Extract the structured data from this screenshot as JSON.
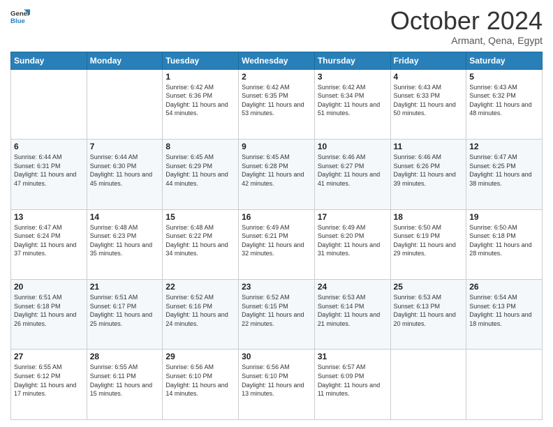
{
  "logo": {
    "text_general": "General",
    "text_blue": "Blue"
  },
  "header": {
    "month": "October 2024",
    "location": "Armant, Qena, Egypt"
  },
  "weekdays": [
    "Sunday",
    "Monday",
    "Tuesday",
    "Wednesday",
    "Thursday",
    "Friday",
    "Saturday"
  ],
  "weeks": [
    [
      {
        "day": "",
        "info": ""
      },
      {
        "day": "",
        "info": ""
      },
      {
        "day": "1",
        "info": "Sunrise: 6:42 AM\nSunset: 6:36 PM\nDaylight: 11 hours and 54 minutes."
      },
      {
        "day": "2",
        "info": "Sunrise: 6:42 AM\nSunset: 6:35 PM\nDaylight: 11 hours and 53 minutes."
      },
      {
        "day": "3",
        "info": "Sunrise: 6:42 AM\nSunset: 6:34 PM\nDaylight: 11 hours and 51 minutes."
      },
      {
        "day": "4",
        "info": "Sunrise: 6:43 AM\nSunset: 6:33 PM\nDaylight: 11 hours and 50 minutes."
      },
      {
        "day": "5",
        "info": "Sunrise: 6:43 AM\nSunset: 6:32 PM\nDaylight: 11 hours and 48 minutes."
      }
    ],
    [
      {
        "day": "6",
        "info": "Sunrise: 6:44 AM\nSunset: 6:31 PM\nDaylight: 11 hours and 47 minutes."
      },
      {
        "day": "7",
        "info": "Sunrise: 6:44 AM\nSunset: 6:30 PM\nDaylight: 11 hours and 45 minutes."
      },
      {
        "day": "8",
        "info": "Sunrise: 6:45 AM\nSunset: 6:29 PM\nDaylight: 11 hours and 44 minutes."
      },
      {
        "day": "9",
        "info": "Sunrise: 6:45 AM\nSunset: 6:28 PM\nDaylight: 11 hours and 42 minutes."
      },
      {
        "day": "10",
        "info": "Sunrise: 6:46 AM\nSunset: 6:27 PM\nDaylight: 11 hours and 41 minutes."
      },
      {
        "day": "11",
        "info": "Sunrise: 6:46 AM\nSunset: 6:26 PM\nDaylight: 11 hours and 39 minutes."
      },
      {
        "day": "12",
        "info": "Sunrise: 6:47 AM\nSunset: 6:25 PM\nDaylight: 11 hours and 38 minutes."
      }
    ],
    [
      {
        "day": "13",
        "info": "Sunrise: 6:47 AM\nSunset: 6:24 PM\nDaylight: 11 hours and 37 minutes."
      },
      {
        "day": "14",
        "info": "Sunrise: 6:48 AM\nSunset: 6:23 PM\nDaylight: 11 hours and 35 minutes."
      },
      {
        "day": "15",
        "info": "Sunrise: 6:48 AM\nSunset: 6:22 PM\nDaylight: 11 hours and 34 minutes."
      },
      {
        "day": "16",
        "info": "Sunrise: 6:49 AM\nSunset: 6:21 PM\nDaylight: 11 hours and 32 minutes."
      },
      {
        "day": "17",
        "info": "Sunrise: 6:49 AM\nSunset: 6:20 PM\nDaylight: 11 hours and 31 minutes."
      },
      {
        "day": "18",
        "info": "Sunrise: 6:50 AM\nSunset: 6:19 PM\nDaylight: 11 hours and 29 minutes."
      },
      {
        "day": "19",
        "info": "Sunrise: 6:50 AM\nSunset: 6:18 PM\nDaylight: 11 hours and 28 minutes."
      }
    ],
    [
      {
        "day": "20",
        "info": "Sunrise: 6:51 AM\nSunset: 6:18 PM\nDaylight: 11 hours and 26 minutes."
      },
      {
        "day": "21",
        "info": "Sunrise: 6:51 AM\nSunset: 6:17 PM\nDaylight: 11 hours and 25 minutes."
      },
      {
        "day": "22",
        "info": "Sunrise: 6:52 AM\nSunset: 6:16 PM\nDaylight: 11 hours and 24 minutes."
      },
      {
        "day": "23",
        "info": "Sunrise: 6:52 AM\nSunset: 6:15 PM\nDaylight: 11 hours and 22 minutes."
      },
      {
        "day": "24",
        "info": "Sunrise: 6:53 AM\nSunset: 6:14 PM\nDaylight: 11 hours and 21 minutes."
      },
      {
        "day": "25",
        "info": "Sunrise: 6:53 AM\nSunset: 6:13 PM\nDaylight: 11 hours and 20 minutes."
      },
      {
        "day": "26",
        "info": "Sunrise: 6:54 AM\nSunset: 6:13 PM\nDaylight: 11 hours and 18 minutes."
      }
    ],
    [
      {
        "day": "27",
        "info": "Sunrise: 6:55 AM\nSunset: 6:12 PM\nDaylight: 11 hours and 17 minutes."
      },
      {
        "day": "28",
        "info": "Sunrise: 6:55 AM\nSunset: 6:11 PM\nDaylight: 11 hours and 15 minutes."
      },
      {
        "day": "29",
        "info": "Sunrise: 6:56 AM\nSunset: 6:10 PM\nDaylight: 11 hours and 14 minutes."
      },
      {
        "day": "30",
        "info": "Sunrise: 6:56 AM\nSunset: 6:10 PM\nDaylight: 11 hours and 13 minutes."
      },
      {
        "day": "31",
        "info": "Sunrise: 6:57 AM\nSunset: 6:09 PM\nDaylight: 11 hours and 11 minutes."
      },
      {
        "day": "",
        "info": ""
      },
      {
        "day": "",
        "info": ""
      }
    ]
  ]
}
